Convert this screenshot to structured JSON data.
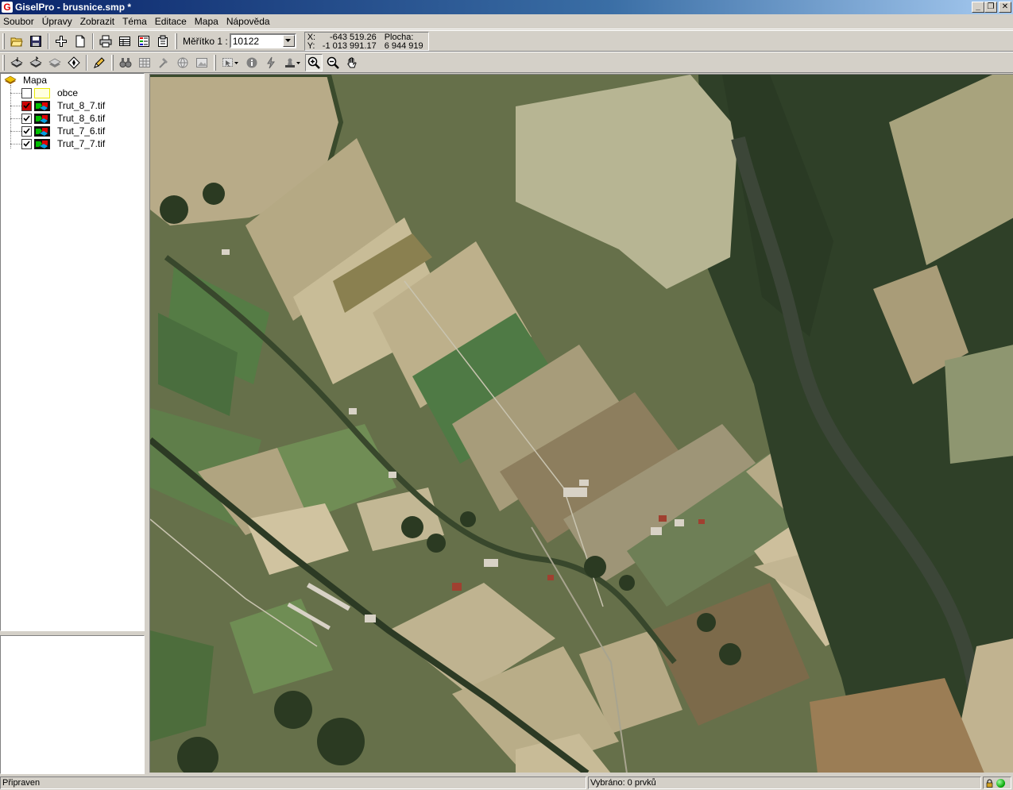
{
  "window": {
    "title": "GiselPro - brusnice.smp *",
    "app_icon_letter": "G"
  },
  "menu": [
    "Soubor",
    "Úpravy",
    "Zobrazit",
    "Téma",
    "Editace",
    "Mapa",
    "Nápověda"
  ],
  "toolbar": {
    "scale_label": "Měřítko 1 :",
    "scale_value": "10122",
    "coord_x_label": "X:",
    "coord_y_label": "Y:",
    "coord_x": "-643 519.26",
    "coord_y": "-1 013 991.17",
    "area_label": "Plocha:",
    "area_value": "6 944 919"
  },
  "layers": {
    "root": "Mapa",
    "items": [
      {
        "name": "obce",
        "checked": false,
        "type": "polygon"
      },
      {
        "name": "Trut_8_7.tif",
        "checked": true,
        "highlight": true,
        "type": "raster"
      },
      {
        "name": "Trut_8_6.tif",
        "checked": true,
        "type": "raster"
      },
      {
        "name": "Trut_7_6.tif",
        "checked": true,
        "type": "raster"
      },
      {
        "name": "Trut_7_7.tif",
        "checked": true,
        "type": "raster"
      }
    ]
  },
  "status": {
    "ready": "Připraven",
    "selected": "Vybráno: 0  prvků"
  },
  "colors": {
    "title_start": "#0a246a",
    "title_end": "#a6caf0",
    "chrome": "#d4d0c8",
    "forest": "#2e3f26",
    "river": "#3f4a3a"
  }
}
